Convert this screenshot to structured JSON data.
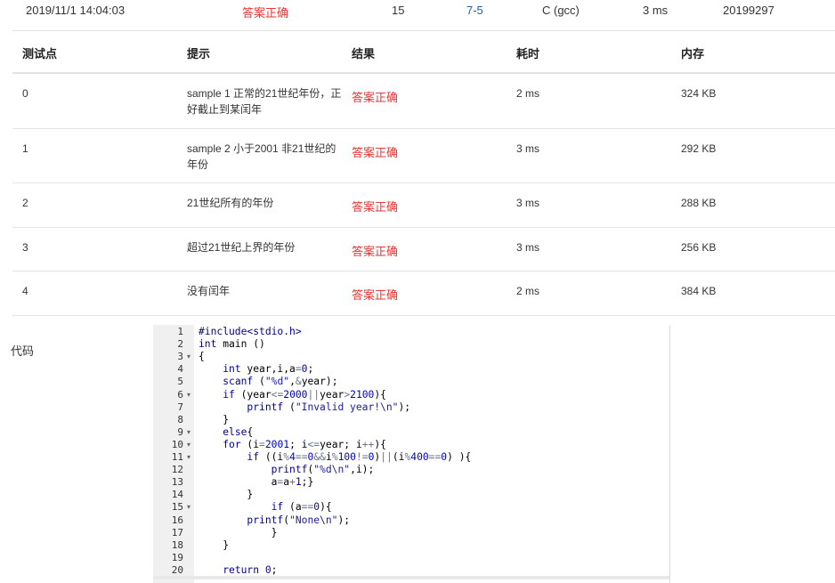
{
  "submission": {
    "time": "2019/11/1 14:04:03",
    "status": "答案正确",
    "score": "15",
    "problem": "7-5",
    "compiler": "C (gcc)",
    "runtime": "3 ms",
    "user": "20199297"
  },
  "table": {
    "headers": [
      "测试点",
      "提示",
      "结果",
      "耗时",
      "内存"
    ],
    "rows": [
      {
        "id": "0",
        "hint": "sample 1 正常的21世纪年份，正好截止到某闰年",
        "result": "答案正确",
        "time": "2 ms",
        "memory": "324 KB"
      },
      {
        "id": "1",
        "hint": "sample 2 小于2001 非21世纪的年份",
        "result": "答案正确",
        "time": "3 ms",
        "memory": "292 KB"
      },
      {
        "id": "2",
        "hint": "21世纪所有的年份",
        "result": "答案正确",
        "time": "3 ms",
        "memory": "288 KB"
      },
      {
        "id": "3",
        "hint": "超过21世纪上界的年份",
        "result": "答案正确",
        "time": "3 ms",
        "memory": "256 KB"
      },
      {
        "id": "4",
        "hint": "没有闰年",
        "result": "答案正确",
        "time": "2 ms",
        "memory": "384 KB"
      }
    ]
  },
  "code": {
    "label": "代码",
    "lines": [
      "#include<stdio.h>",
      "int main ()",
      "{",
      "    int year,i,a=0;",
      "    scanf (\"%d\",&year);",
      "    if (year<=2000||year>2100){",
      "        printf (\"Invalid year!\\n\");",
      "    }",
      "    else{",
      "    for (i=2001; i<=year; i++){",
      "        if ((i%4==0&&i%100!=0)||(i%400==0) ){",
      "            printf(\"%d\\n\",i);",
      "            a=a+1;}",
      "        }",
      "            if (a==0){",
      "        printf(\"None\\n\");",
      "            }",
      "    }",
      "",
      "    return 0;"
    ],
    "line_numbers": [
      "1",
      "2",
      "3",
      "4",
      "5",
      "6",
      "7",
      "8",
      "9",
      "10",
      "11",
      "12",
      "13",
      "14",
      "15",
      "16",
      "17",
      "18",
      "19",
      "20"
    ],
    "fold_markers": [
      "3",
      "6",
      "9",
      "10",
      "11",
      "15"
    ]
  }
}
